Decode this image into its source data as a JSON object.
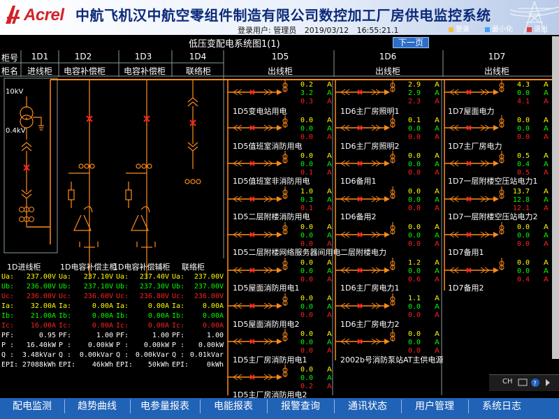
{
  "header": {
    "logo": "Acrel",
    "title": "中航飞机汉中航空零组件制造有限公司数控加工厂房供电监控系统",
    "user_label": "登录用户: 管理员",
    "date": "2019/03/12",
    "time": "16:55:21.1",
    "login": "登录",
    "minimize": "最小化",
    "exit": "退出"
  },
  "page": {
    "diagram_title": "低压变配电系统图1(1)",
    "next_page": "下一页"
  },
  "columns": {
    "row_label_1": "柜号",
    "row_label_2": "柜名",
    "cabinets": [
      {
        "id": "1D1",
        "name": "进线柜"
      },
      {
        "id": "1D2",
        "name": "电容补偿柜"
      },
      {
        "id": "1D3",
        "name": "电容补偿柜"
      },
      {
        "id": "1D4",
        "name": "联络柜"
      },
      {
        "id": "1D5",
        "name": "出线柜"
      },
      {
        "id": "1D6",
        "name": "出线柜"
      },
      {
        "id": "1D7",
        "name": "出线柜"
      }
    ]
  },
  "transformer": {
    "hv": "10kV",
    "lv": "0.4kV"
  },
  "unit_a": "A",
  "feeders_1d5": [
    {
      "name": "1D5变电站用电",
      "vals": [
        "0.2",
        "3.2",
        "0.3"
      ]
    },
    {
      "name": "1D5值班室消防用电",
      "vals": [
        "0.0",
        "0.0",
        "0.0"
      ]
    },
    {
      "name": "1D5值班室非消防用电",
      "vals": [
        "0.0",
        "0.0",
        "0.1"
      ]
    },
    {
      "name": "1D5二层附楼消防用电",
      "vals": [
        "1.0",
        "0.3",
        "0.1"
      ]
    },
    {
      "name": "1D5二层附楼网络服务器间用电",
      "vals": [
        "0.0",
        "0.0",
        "0.0"
      ]
    },
    {
      "name": "1D5屋面消防用电1",
      "vals": [
        "0.0",
        "0.0",
        "0.0"
      ]
    },
    {
      "name": "1D5屋面消防用电2",
      "vals": [
        "0.0",
        "0.0",
        "0.0"
      ]
    },
    {
      "name": "1D5主厂房消防用电1",
      "vals": [
        "0.0",
        "0.0",
        "0.0"
      ]
    },
    {
      "name": "1D5主厂房消防用电2",
      "vals": [
        "0.0",
        "0.0",
        "0.2"
      ]
    }
  ],
  "feeders_1d6": [
    {
      "name": "1D6主厂房照明1",
      "vals": [
        "2.9",
        "2.9",
        "2.3"
      ]
    },
    {
      "name": "1D6主厂房照明2",
      "vals": [
        "0.1",
        "0.0",
        "0.0"
      ]
    },
    {
      "name": "1D6备用1",
      "vals": [
        "0.0",
        "0.0",
        "0.0"
      ]
    },
    {
      "name": "1D6备用2",
      "vals": [
        "0.0",
        "0.0",
        "0.0"
      ]
    },
    {
      "name": "二层附楼电力",
      "vals": [
        "0.0",
        "0.0",
        "0.0"
      ]
    },
    {
      "name": "1D6主厂房电力1",
      "vals": [
        "1.2",
        "0.0",
        "0.6"
      ]
    },
    {
      "name": "1D6主厂房电力2",
      "vals": [
        "1.1",
        "0.0",
        "0.0"
      ]
    },
    {
      "name": "2002b号消防泵站AT主供电源",
      "vals": [
        "0.0",
        "0.0",
        "0.0"
      ]
    }
  ],
  "feeders_1d7": [
    {
      "name": "1D7屋面电力",
      "vals": [
        "4.3",
        "0.0",
        "4.1"
      ]
    },
    {
      "name": "1D7主厂房电力",
      "vals": [
        "0.0",
        "0.0",
        "0.0"
      ]
    },
    {
      "name": "1D7一层附楼空压站电力1",
      "vals": [
        "0.5",
        "0.4",
        "0.5"
      ]
    },
    {
      "name": "1D7一层附楼空压站电力2",
      "vals": [
        "13.7",
        "12.8",
        "12.1"
      ]
    },
    {
      "name": "1D7备用1",
      "vals": [
        "0.0",
        "0.0",
        "0.0"
      ]
    },
    {
      "name": "1D7备用2",
      "vals": [
        "0.0",
        "0.0",
        "0.4"
      ]
    }
  ],
  "meas_titles": [
    "1D进线柜",
    "1D电容补偿主柜",
    "1D电容补偿辅柜",
    "联络柜"
  ],
  "meas_labels": [
    "Ua:",
    "Ub:",
    "Uc:",
    "Ia:",
    "Ib:",
    "Ic:",
    "PF:",
    "P :",
    "Q :",
    "EPI:"
  ],
  "meas": [
    [
      "237.00V",
      "236.00V",
      "236.00V",
      "32.00A",
      "21.00A",
      "16.00A",
      "0.95",
      "16.40kW",
      "3.48kVar",
      "27088kWh"
    ],
    [
      "237.10V",
      "237.10V",
      "236.60V",
      "0.00A",
      "0.00A",
      "0.00A",
      "1.00",
      "0.00kW",
      "0.00kVar",
      "46kWh"
    ],
    [
      "237.40V",
      "237.30V",
      "236.80V",
      "0.00A",
      "0.00A",
      "0.00A",
      "1.00",
      "0.00kW",
      "0.00kVar",
      "50kWh"
    ],
    [
      "237.00V",
      "237.00V",
      "236.00V",
      "0.00A",
      "0.00A",
      "0.00A",
      "1.00",
      "0.00kW",
      "0.01kVar",
      "0kWh"
    ]
  ],
  "nav": [
    "配电监测",
    "趋势曲线",
    "电参量报表",
    "电能报表",
    "报警查询",
    "通讯状态",
    "用户管理",
    "系统日志"
  ],
  "tray": {
    "ime": "CH"
  },
  "colors": {
    "bus": "#ff8c1a",
    "breaker": "#ff2020",
    "phase_a": "#ffff00",
    "phase_b": "#00ff00",
    "phase_c": "#ff2020",
    "nav": "#2062b6"
  }
}
